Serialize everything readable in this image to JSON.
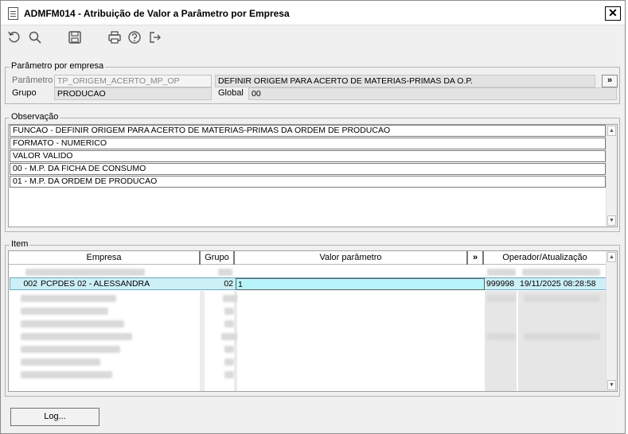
{
  "window": {
    "title": "ADMFM014 - Atribuição de Valor a Parâmetro por Empresa",
    "close": "✕"
  },
  "toolbar": {
    "icons": [
      "undo-icon",
      "search-icon",
      "save-icon",
      "print-icon",
      "help-icon",
      "exit-icon"
    ]
  },
  "param_group": {
    "legend": "Parâmetro por empresa",
    "parametro_label": "Parâmetro",
    "parametro_value": "TP_ORIGEM_ACERTO_MP_OP",
    "descricao_value": "DEFINIR ORIGEM PARA ACERTO DE MATERIAS-PRIMAS DA O.P.",
    "more_button": "»",
    "grupo_label": "Grupo",
    "grupo_value": "PRODUCAO",
    "global_label": "Global",
    "global_value": "00"
  },
  "observacao": {
    "legend": "Observação",
    "lines": [
      "FUNCAO - DEFINIR ORIGEM PARA ACERTO DE MATERIAS-PRIMAS DA ORDEM DE PRODUCAO",
      "FORMATO - NUMERICO",
      "VALOR VALIDO",
      " 00 - M.P. DA FICHA DE CONSUMO",
      " 01 - M.P. DA ORDEM DE PRODUCAO"
    ]
  },
  "item": {
    "legend": "Item",
    "columns": {
      "empresa": "Empresa",
      "grupo": "Grupo",
      "valor": "Valor parâmetro",
      "more": "»",
      "operador": "Operador/Atualização"
    },
    "selected_row": {
      "codigo": "002",
      "empresa": "PCPDES 02 - ALESSANDRA",
      "grupo": "02",
      "valor": "1",
      "operador": "999998",
      "atualizacao": "19/11/2025 08:28:58"
    }
  },
  "log_button": "Log..."
}
